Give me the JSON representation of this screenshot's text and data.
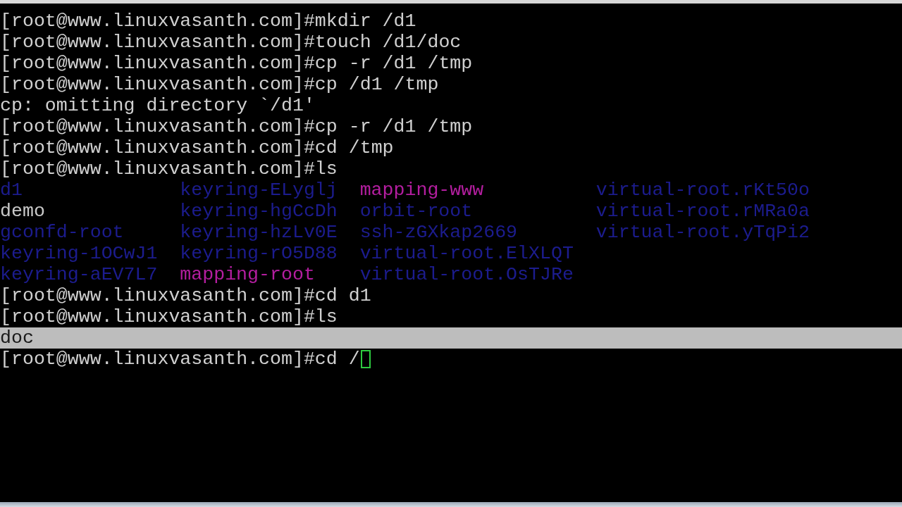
{
  "terminal": {
    "lines": [
      {
        "kind": "prompt",
        "text": "[root@www.linuxvasanth.com]#mkdir /d1",
        "selected": false,
        "cursor": false
      },
      {
        "kind": "prompt",
        "text": "[root@www.linuxvasanth.com]#touch /d1/doc",
        "selected": false,
        "cursor": false
      },
      {
        "kind": "prompt",
        "text": "[root@www.linuxvasanth.com]#cp -r /d1 /tmp",
        "selected": false,
        "cursor": false
      },
      {
        "kind": "prompt",
        "text": "[root@www.linuxvasanth.com]#cp /d1 /tmp",
        "selected": false,
        "cursor": false
      },
      {
        "kind": "output",
        "text": "cp: omitting directory `/d1'",
        "selected": false
      },
      {
        "kind": "prompt",
        "text": "[root@www.linuxvasanth.com]#cp -r /d1 /tmp",
        "selected": false,
        "cursor": false
      },
      {
        "kind": "prompt",
        "text": "[root@www.linuxvasanth.com]#cd /tmp",
        "selected": false,
        "cursor": false
      },
      {
        "kind": "prompt",
        "text": "[root@www.linuxvasanth.com]#ls",
        "selected": false,
        "cursor": false
      },
      {
        "kind": "listing",
        "selected": false,
        "rows": [
          [
            {
              "name": "d1",
              "color": "#1c1c8e"
            },
            {
              "name": "keyring-ELyglj",
              "color": "#1c1c8e"
            },
            {
              "name": "mapping-www",
              "color": "#b41ea0"
            },
            {
              "name": "virtual-root.rKt50o",
              "color": "#1c1c8e"
            }
          ],
          [
            {
              "name": "demo",
              "color": "#c8c8c8"
            },
            {
              "name": "keyring-hgCcDh",
              "color": "#1c1c8e"
            },
            {
              "name": "orbit-root",
              "color": "#1c1c8e"
            },
            {
              "name": "virtual-root.rMRa0a",
              "color": "#1c1c8e"
            }
          ],
          [
            {
              "name": "gconfd-root",
              "color": "#1c1c8e"
            },
            {
              "name": "keyring-hzLv0E",
              "color": "#1c1c8e"
            },
            {
              "name": "ssh-zGXkap2669",
              "color": "#1c1c8e"
            },
            {
              "name": "virtual-root.yTqPi2",
              "color": "#1c1c8e"
            }
          ],
          [
            {
              "name": "keyring-1OCwJ1",
              "color": "#1c1c8e"
            },
            {
              "name": "keyring-rO5D88",
              "color": "#1c1c8e"
            },
            {
              "name": "virtual-root.ElXLQT",
              "color": "#1c1c8e"
            }
          ],
          [
            {
              "name": "keyring-aEV7L7",
              "color": "#1c1c8e"
            },
            {
              "name": "mapping-root",
              "color": "#b41ea0"
            },
            {
              "name": "virtual-root.OsTJRe",
              "color": "#1c1c8e"
            }
          ]
        ]
      },
      {
        "kind": "prompt",
        "text": "[root@www.linuxvasanth.com]#cd d1",
        "selected": false,
        "cursor": false
      },
      {
        "kind": "prompt",
        "text": "[root@www.linuxvasanth.com]#ls",
        "selected": false,
        "cursor": false
      },
      {
        "kind": "output",
        "text": "doc",
        "selected": true
      },
      {
        "kind": "prompt",
        "text": "[root@www.linuxvasanth.com]#cd /",
        "selected": false,
        "cursor": true
      }
    ]
  }
}
